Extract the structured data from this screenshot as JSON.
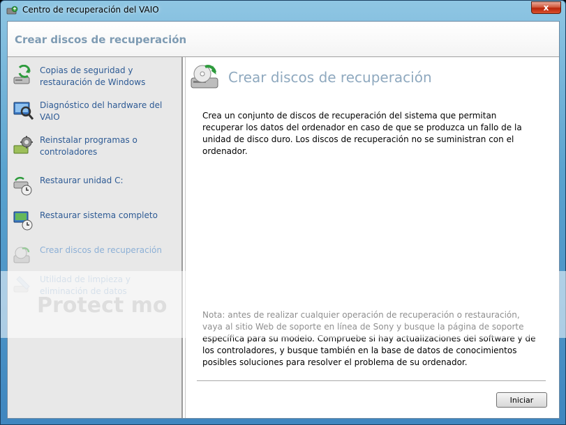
{
  "window": {
    "title": "Centro de recuperación del VAIO",
    "close_label": "x"
  },
  "header": {
    "title": "Crear discos de recuperación"
  },
  "sidebar": {
    "items": [
      {
        "label": "Copias de seguridad y restauración de Windows",
        "icon": "backup-restore-icon",
        "state": "normal"
      },
      {
        "label": "Diagnóstico del hardware del VAIO",
        "icon": "hardware-diagnostic-icon",
        "state": "normal"
      },
      {
        "label": "Reinstalar programas o controladores",
        "icon": "reinstall-programs-icon",
        "state": "normal"
      },
      {
        "label": "Restaurar unidad C:",
        "icon": "restore-drive-icon",
        "state": "normal"
      },
      {
        "label": "Restaurar sistema completo",
        "icon": "restore-system-icon",
        "state": "normal"
      },
      {
        "label": "Crear discos de recuperación",
        "icon": "create-recovery-disc-icon",
        "state": "active"
      },
      {
        "label": "Utilidad de limpieza y eliminación de datos",
        "icon": "data-erase-icon",
        "state": "disabled"
      }
    ]
  },
  "main": {
    "title": "Crear discos de recuperación",
    "description": "Crea un conjunto de discos de recuperación del sistema que permitan recuperar los datos del ordenador en caso de que se produzca un fallo de la unidad de disco duro. Los discos de recuperación no se suministran con el ordenador.",
    "note": "Nota: antes de realizar cualquier operación de recuperación o restauración, vaya al sitio Web de soporte en línea de Sony y busque la página de soporte específica para su modelo. Compruebe si hay actualizaciones del software y de los controladores, y busque también en la base de datos de conocimientos posibles soluciones para resolver el problema de su ordenador.",
    "start_button": "Iniciar"
  },
  "watermark": {
    "text": "Protect mo"
  },
  "colors": {
    "header_title": "#7e9bb3",
    "link": "#2d5a94",
    "active_link": "#8db0d6",
    "main_title": "#8fa9bf"
  }
}
